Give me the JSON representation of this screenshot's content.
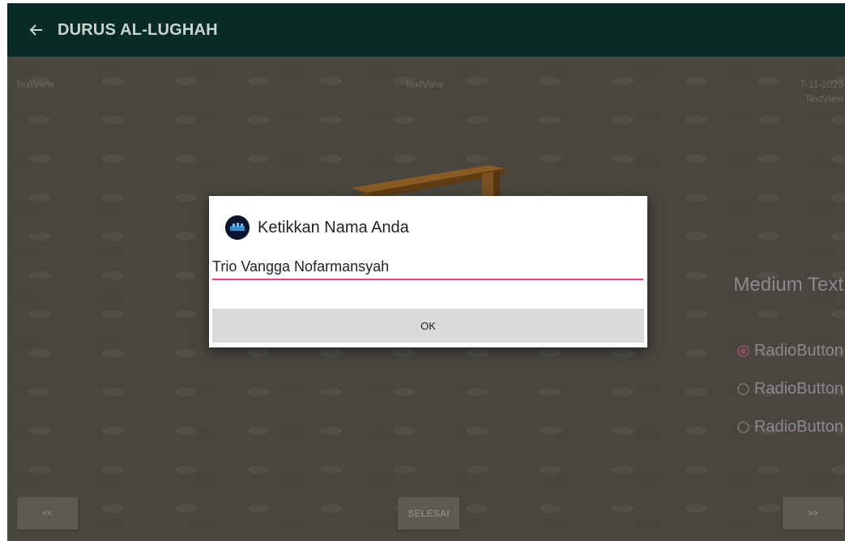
{
  "toolbar": {
    "title": "DURUS AL-LUGHAH",
    "back_icon": "arrow-left-icon"
  },
  "content": {
    "textview_left": "TextView",
    "textview_center": "TextView",
    "date": "7-11-2023",
    "textview_right": "TextView",
    "image": "wooden-bench-image",
    "medium_text": "Medium Text",
    "radio_options": [
      {
        "label": "RadioButton",
        "checked": true
      },
      {
        "label": "RadioButton",
        "checked": false
      },
      {
        "label": "RadioButton",
        "checked": false
      }
    ],
    "buttons": {
      "prev": "<<",
      "done": "SELESAI",
      "next": ">>"
    }
  },
  "dialog": {
    "title": "Ketikkan Nama Anda",
    "icon": "app-logo-icon",
    "input_value": "Trio Vangga Nofarmansyah",
    "ok_label": "OK"
  },
  "colors": {
    "toolbar": "#062c25",
    "input_underline": "#e0457c",
    "radio_checked": "#8c4a64",
    "ok_button": "#dadada"
  }
}
